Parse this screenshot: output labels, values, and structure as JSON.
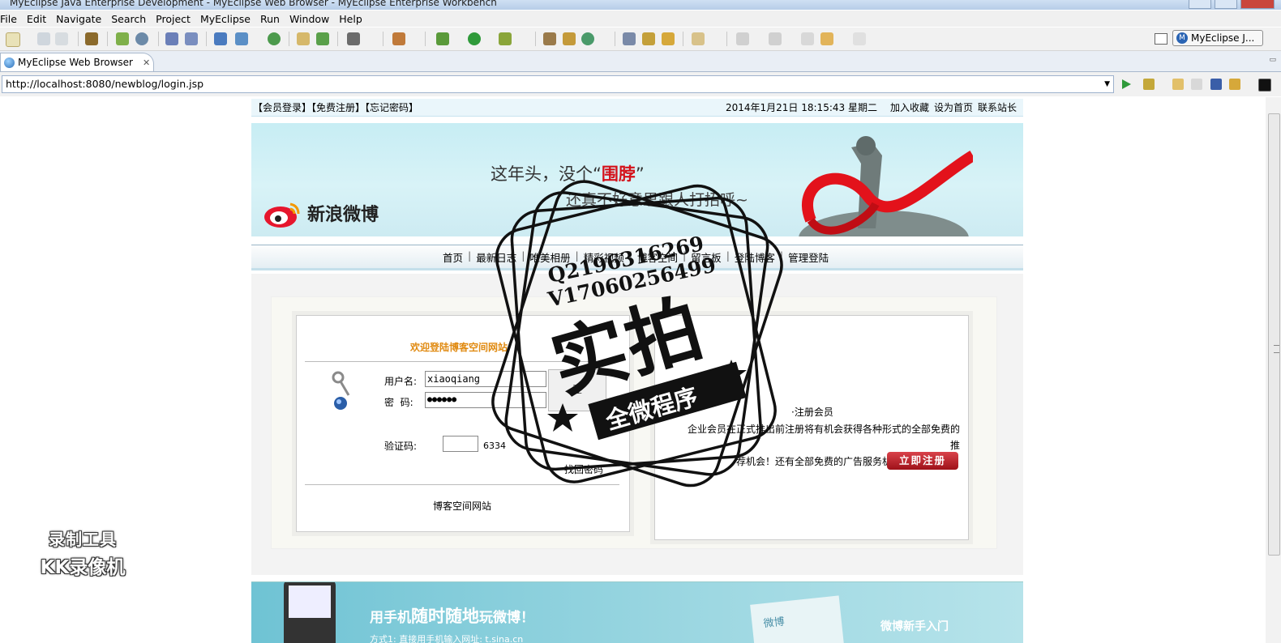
{
  "window": {
    "title": "MyEclipse Java Enterprise Development - MyEclipse Web Browser - MyEclipse Enterprise Workbench"
  },
  "menu": [
    "File",
    "Edit",
    "Navigate",
    "Search",
    "Project",
    "MyEclipse",
    "Run",
    "Window",
    "Help"
  ],
  "perspective": {
    "label": "MyEclipse J..."
  },
  "tab": {
    "label": "MyEclipse Web Browser",
    "close": "✕"
  },
  "browser": {
    "url": "http://localhost:8080/newblog/login.jsp"
  },
  "site": {
    "topnav": {
      "left": "【会员登录】【免费注册】【忘记密码】",
      "datetime": "2014年1月21日 18:15:43  星期二",
      "links": [
        "加入收藏",
        "设为首页",
        "联系站长"
      ]
    },
    "banner": {
      "line1_pre": "这年头，没个",
      "line1_quote_open": "“",
      "line1_red": "围脖",
      "line1_quote_close": "”",
      "line2": "还真不好意思跟人打招呼~",
      "brand": "新浪微博"
    },
    "nav": [
      "首页",
      "最新日志",
      "唯美相册",
      "精彩视频",
      "博客空间",
      "留言板",
      "登陆博客",
      "管理登陆"
    ],
    "nav_sep": "|",
    "login": {
      "welcome": "欢迎登陆博客空间网站",
      "username_label": "用户名:",
      "username_value": "xiaoqiang",
      "password_label": "密  码:",
      "password_value": "●●●●●●",
      "captcha_label": "验证码:",
      "captcha_value": "",
      "captcha_code": "6334",
      "login_button": "登",
      "forgot": "找回密码",
      "footer": "博客空间网站"
    },
    "register": {
      "title": "·注册会员",
      "desc_line1": "企业会员在正式推出前注册将有机会获得各种形式的全部免费的推",
      "desc_line2": "荐机会！还有全部免费的广告服务机会！机不可失！",
      "button": "立即注册"
    },
    "bottom_banner": {
      "t1_a": "用手机",
      "t1_b": "随时随地",
      "t1_c": "玩微博！",
      "t2": "方式1: 直接用手机输入网址: t.sina.cn",
      "card": "微博",
      "right": "微博新手入门"
    }
  },
  "overlay": {
    "kk_line1": "录制工具",
    "kk_line2": "KK录像机",
    "stamp_q": "Q2196316269",
    "stamp_v": "V17060256499",
    "stamp_big": "实拍",
    "stamp_ribbon": "全微程序"
  },
  "colors": {
    "accent_orange": "#e08a11",
    "register_red": "#c62a32",
    "banner_red": "#d4111a"
  }
}
